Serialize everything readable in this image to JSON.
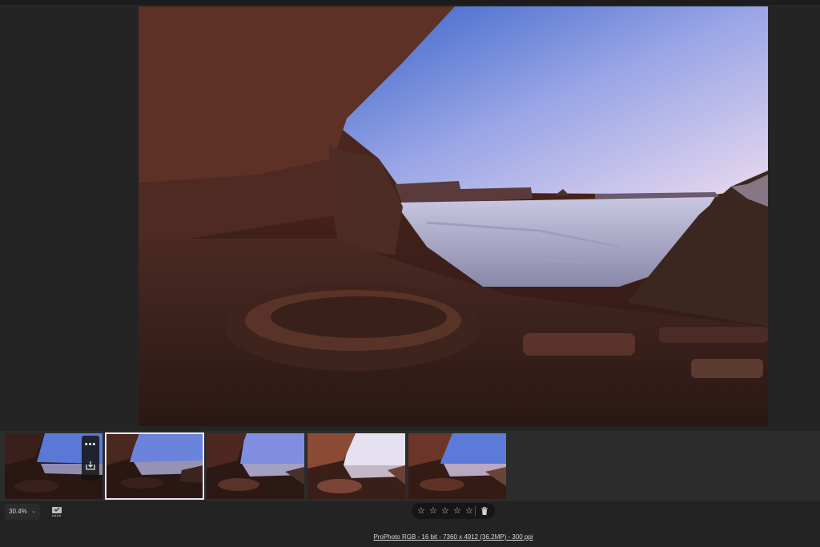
{
  "preview": {
    "image_alt": "Desert canyon cave ruin at sunrise"
  },
  "filmstrip": {
    "thumbnails": [
      {
        "label": "canyon-ruin-1",
        "selected": false,
        "hover": true
      },
      {
        "label": "canyon-ruin-2",
        "selected": true,
        "hover": false
      },
      {
        "label": "canyon-ruin-3",
        "selected": false,
        "hover": false
      },
      {
        "label": "canyon-ruin-4",
        "selected": false,
        "hover": false
      },
      {
        "label": "canyon-ruin-5",
        "selected": false,
        "hover": false
      }
    ],
    "more_icon": "•••",
    "save_icon": "download-icon"
  },
  "toolbar": {
    "zoom_value": "30.4%",
    "zoom_chevron": "⌄",
    "compare_icon": "compare-view-icon",
    "rating_stars": [
      "☆",
      "☆",
      "☆",
      "☆",
      "☆"
    ],
    "delete_icon": "trash-icon"
  },
  "status": {
    "image_info": "ProPhoto RGB - 16 bit - 7360 x 4912 (36.2MP) - 300 ppi"
  }
}
